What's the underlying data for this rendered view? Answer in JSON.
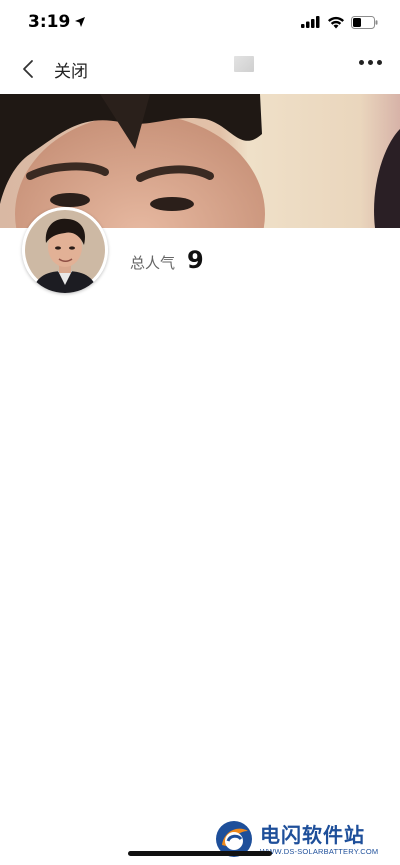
{
  "status_bar": {
    "time": "3:19"
  },
  "nav": {
    "close_label": "关闭"
  },
  "profile": {
    "popularity_label": "总人气",
    "popularity_value": "9"
  },
  "watermark": {
    "title": "电闪软件站",
    "url": "WWW.DS-SOLARBATTERY.COM"
  },
  "colors": {
    "watermark_blue": "#1e4f9a",
    "watermark_orange": "#f08a1c"
  }
}
